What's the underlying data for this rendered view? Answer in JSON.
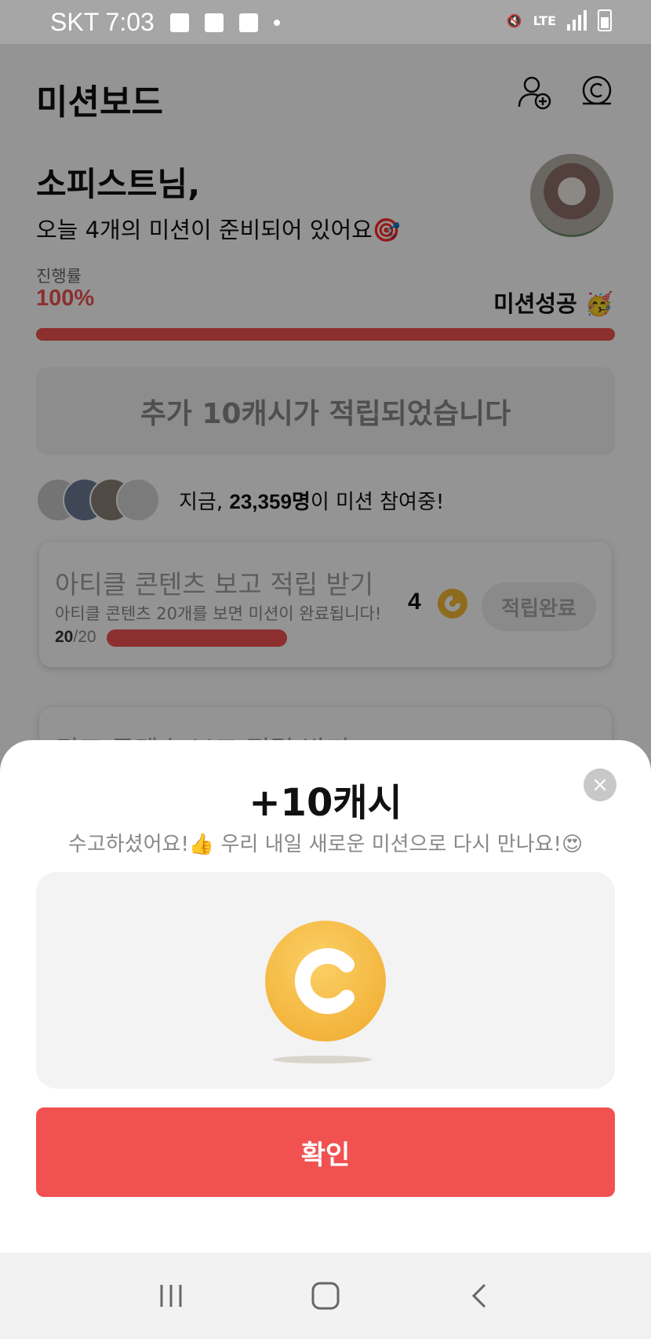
{
  "status_bar": {
    "carrier_time": "SKT 7:03",
    "network": "LTE"
  },
  "header": {
    "title": "미션보드"
  },
  "greeting": {
    "name": "소피스트님,",
    "subtitle": "오늘 4개의 미션이 준비되어 있어요🎯"
  },
  "progress": {
    "label": "진행률",
    "value_text": "100%",
    "value": 1.0,
    "status": "미션성공 🥳"
  },
  "notice": {
    "text": "추가 10캐시가 적립되었습니다"
  },
  "participants": {
    "prefix": "지금, ",
    "count": "23,359명",
    "suffix": "이 미션 참여중!"
  },
  "missions": [
    {
      "title": "아티클 콘텐츠 보고 적립 받기",
      "description": "아티클 콘텐츠 20개를 보면 미션이 완료됩니다!",
      "done": "20",
      "total": "/20",
      "progress": 1.0,
      "reward": "4",
      "button_label": "적립완료"
    },
    {
      "title": "퀴즈 콘텐츠 보고 적립 받기"
    }
  ],
  "sheet": {
    "title": "+10캐시",
    "message": "수고하셨어요!👍 우리 내일 새로운 미션으로 다시 만나요!😍",
    "close_icon": "×",
    "confirm_label": "확인"
  },
  "colors": {
    "accent": "#f15151",
    "coin": "#f5b933"
  },
  "icons": [
    "add-friend-icon",
    "cash-icon",
    "close-icon",
    "coin-icon",
    "recent-apps-icon",
    "home-icon",
    "back-icon"
  ]
}
